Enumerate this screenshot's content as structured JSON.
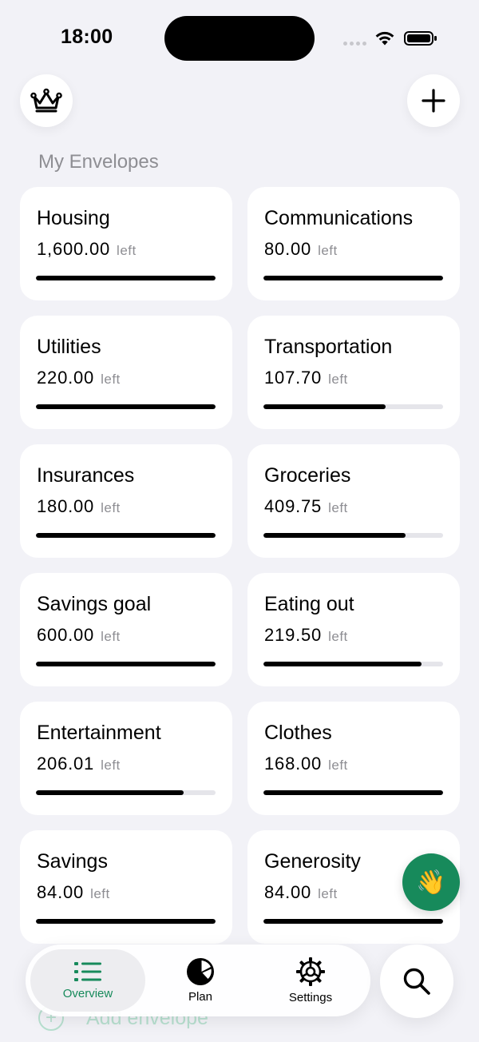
{
  "status_bar": {
    "time": "18:00"
  },
  "header": {
    "section_title": "My Envelopes"
  },
  "envelopes": [
    {
      "name": "Housing",
      "amount": "1,600.00",
      "left_label": "left",
      "progress": 1.0
    },
    {
      "name": "Communications",
      "amount": "80.00",
      "left_label": "left",
      "progress": 1.0
    },
    {
      "name": "Utilities",
      "amount": "220.00",
      "left_label": "left",
      "progress": 1.0
    },
    {
      "name": "Transportation",
      "amount": "107.70",
      "left_label": "left",
      "progress": 0.68
    },
    {
      "name": "Insurances",
      "amount": "180.00",
      "left_label": "left",
      "progress": 1.0
    },
    {
      "name": "Groceries",
      "amount": "409.75",
      "left_label": "left",
      "progress": 0.79
    },
    {
      "name": "Savings goal",
      "amount": "600.00",
      "left_label": "left",
      "progress": 1.0
    },
    {
      "name": "Eating out",
      "amount": "219.50",
      "left_label": "left",
      "progress": 0.88
    },
    {
      "name": "Entertainment",
      "amount": "206.01",
      "left_label": "left",
      "progress": 0.82
    },
    {
      "name": "Clothes",
      "amount": "168.00",
      "left_label": "left",
      "progress": 1.0
    },
    {
      "name": "Savings",
      "amount": "84.00",
      "left_label": "left",
      "progress": 1.0
    },
    {
      "name": "Generosity",
      "amount": "84.00",
      "left_label": "left",
      "progress": 1.0
    }
  ],
  "add_envelope": {
    "label": "Add envelope"
  },
  "tabs": [
    {
      "label": "Overview",
      "icon": "list-icon",
      "active": true
    },
    {
      "label": "Plan",
      "icon": "pie-chart-icon",
      "active": false
    },
    {
      "label": "Settings",
      "icon": "gear-icon",
      "active": false
    }
  ],
  "icons": {
    "crown": "crown-icon",
    "add": "plus-icon",
    "wave": "👋",
    "search": "search-icon"
  },
  "colors": {
    "accent": "#178A5B",
    "background": "#F2F2F7",
    "card": "#FFFFFF",
    "secondary_text": "#8E8E93",
    "progress_track": "#E5E5EA",
    "progress_fill": "#000000"
  }
}
